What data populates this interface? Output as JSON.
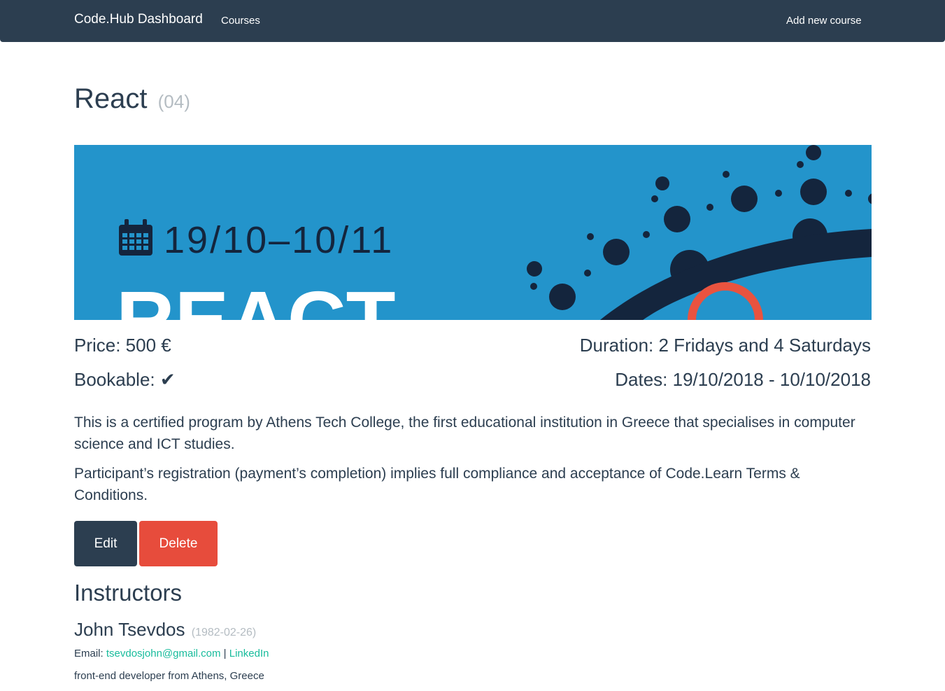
{
  "navbar": {
    "brand": "Code.Hub Dashboard",
    "courses_link": "Courses",
    "add_course_link": "Add new course",
    "background_color": "#2c3e50"
  },
  "course": {
    "title": "React",
    "code": "(04)",
    "banner": {
      "dates_text": "19/10–10/11",
      "title_text": "REACT",
      "background_color": "#2394cb",
      "dark_color": "#14253d",
      "accent_color": "#e9533f",
      "icon": "calendar-icon"
    },
    "price": "Price: 500 €",
    "bookable_label": "Bookable:",
    "bookable_mark": "✔",
    "duration": "Duration: 2 Fridays and 4 Saturdays",
    "dates": "Dates: 19/10/2018 - 10/10/2018",
    "description": [
      "This is a certified program by Athens Tech College, the first educational institution in Greece that specialises in computer science and ICT studies.",
      "Participant’s registration (payment’s completion) implies full compliance and acceptance of Code.Learn Terms & Conditions."
    ]
  },
  "actions": {
    "edit_label": "Edit",
    "delete_label": "Delete",
    "edit_color": "#2c3e50",
    "delete_color": "#e74c3c"
  },
  "instructors": {
    "heading": "Instructors",
    "items": [
      {
        "name": "John Tsevdos",
        "dob": "(1982-02-26)",
        "email_label": "Email:",
        "email": "tsevdosjohn@gmail.com",
        "separator": "|",
        "linkedin": "LinkedIn",
        "bio": "front-end developer from Athens, Greece"
      }
    ],
    "link_color": "#18bc9c"
  }
}
